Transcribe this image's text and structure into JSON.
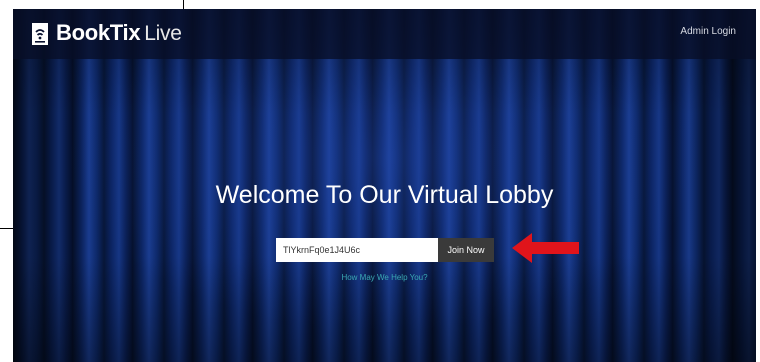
{
  "header": {
    "brand_name": "BookTix",
    "brand_suffix": "Live",
    "admin_login": "Admin Login"
  },
  "main": {
    "title": "Welcome To Our Virtual Lobby",
    "join_code": {
      "value": "TlYkrnFq0e1J4U6c",
      "placeholder": ""
    },
    "join_button": "Join Now",
    "help_link": "How May We Help You?"
  },
  "annotation": {
    "arrow_color": "#e0141b"
  },
  "icons": {
    "logo": "booktix-logo-icon",
    "arrow": "red-arrow-icon"
  },
  "colors": {
    "topbar": "#080e26",
    "curtain": "#0c2563",
    "help_link": "#3aa9b4",
    "button": "#3a3a3a"
  }
}
